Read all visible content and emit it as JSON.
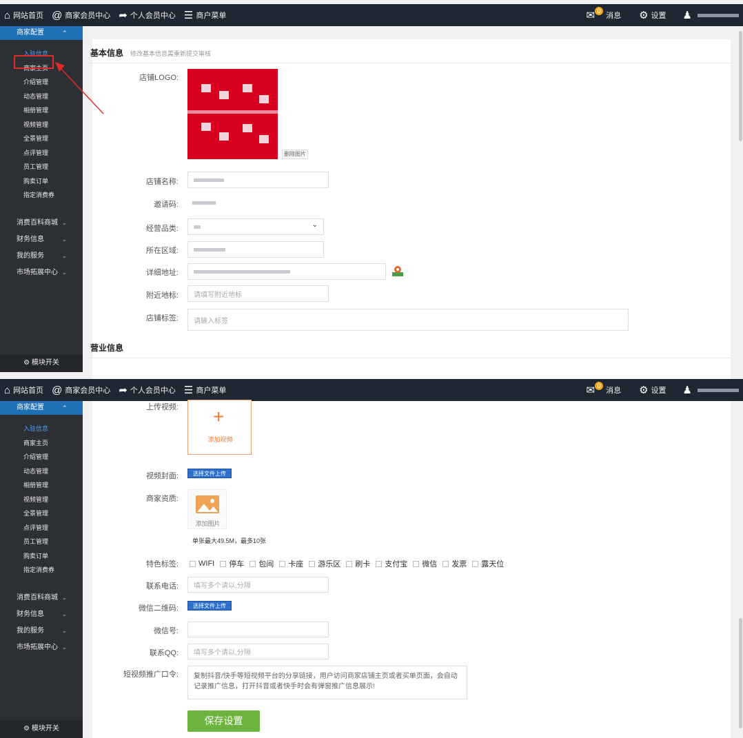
{
  "topbar": {
    "home": "网站首页",
    "merchant_member": "商家会员中心",
    "personal_member": "个人会员中心",
    "merchant_menu": "商户菜单",
    "messages": "消息",
    "message_count": "0",
    "settings": "设置"
  },
  "sidebar": {
    "group": "商家配置",
    "items": [
      "入驻信息",
      "商家主页",
      "介绍管理",
      "动态管理",
      "相册管理",
      "视频管理",
      "全景管理",
      "点评管理",
      "员工管理",
      "购卖订单",
      "指定消费券"
    ],
    "sections": [
      "消费百科商城",
      "财务信息",
      "我的服务",
      "市场拓展中心"
    ],
    "footer": "模块开关"
  },
  "basic": {
    "title": "基本信息",
    "subtitle": "修改基本信息需重新提交审核",
    "logo_label": "店铺LOGO:",
    "delete_image": "删除图片",
    "name_label": "店铺名称:",
    "invite_label": "邀请码:",
    "category_label": "经营品类:",
    "region_label": "所在区域:",
    "address_label": "详细地址:",
    "landmark_label": "附近地标:",
    "landmark_placeholder": "请填写附近地标",
    "tag_label": "店铺标签:",
    "tag_placeholder": "请输入标签"
  },
  "business": {
    "title": "营业信息"
  },
  "media": {
    "video_label": "上传视频:",
    "add_video": "添加视频",
    "cover_label": "视频封面:",
    "choose_file": "选择文件上传",
    "qualification_label": "商家资质:",
    "add_image": "添加图片",
    "limit_tip": "单张最大49.5M，最多10张"
  },
  "features": {
    "label": "特色标签:",
    "options": [
      "WIFI",
      "停车",
      "包间",
      "卡座",
      "游乐区",
      "刷卡",
      "支付宝",
      "微信",
      "发票",
      "露天位"
    ]
  },
  "contact": {
    "phone_label": "联系电话:",
    "phone_placeholder": "填写多个请以,分隔",
    "wechat_qr_label": "微信二维码:",
    "wechat_id_label": "微信号:",
    "qq_label": "联系QQ:",
    "qq_placeholder": "填写多个请以,分隔",
    "promo_label": "短视频推广口令:",
    "promo_placeholder": "复制抖音/快手等短视频平台的分享链接，用户访问商家店铺主页或者买单页面，会自动记录推广信息，打开抖音或者快手时会有弹窗推广信息展示!"
  },
  "save_button": "保存设置"
}
